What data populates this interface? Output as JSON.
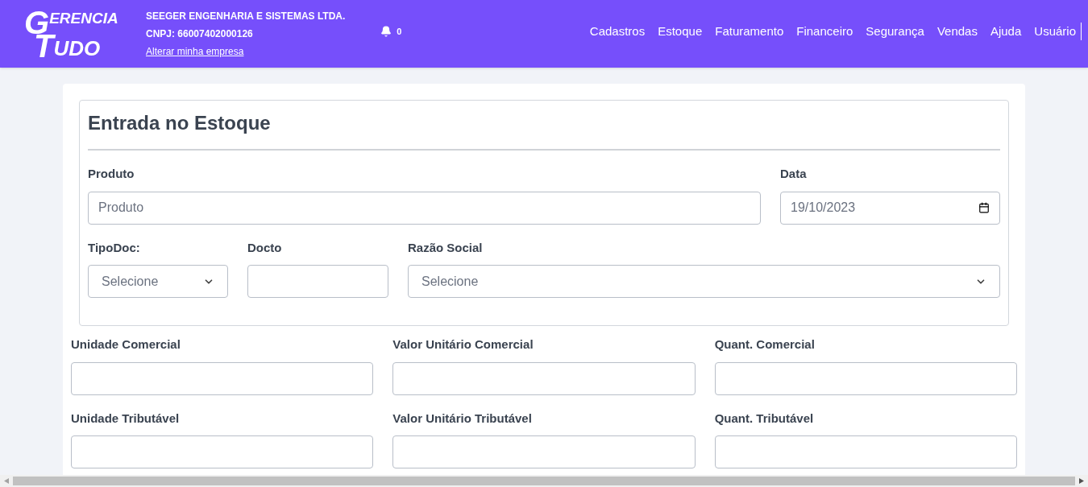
{
  "header": {
    "logo": [
      "G",
      "ERENCIA",
      "T",
      "UDO"
    ],
    "company": "SEEGER ENGENHARIA E SISTEMAS LTDA.",
    "cnpj": "CNPJ: 66007402000126",
    "change_link": "Alterar minha empresa",
    "notifications": "0",
    "nav": [
      "Cadastros",
      "Estoque",
      "Faturamento",
      "Financeiro",
      "Segurança",
      "Vendas",
      "Ajuda",
      "Usuário"
    ]
  },
  "form": {
    "title": "Entrada no Estoque",
    "product": {
      "label": "Produto",
      "placeholder": "Produto"
    },
    "date": {
      "label": "Data",
      "value": "19/10/2023"
    },
    "doc_type": {
      "label": "TipoDoc:",
      "value": "Selecione"
    },
    "doc_number": {
      "label": "Docto"
    },
    "company_name": {
      "label": "Razão Social",
      "value": "Selecione"
    },
    "fields": [
      {
        "label": "Unidade Comercial"
      },
      {
        "label": "Valor Unitário Comercial"
      },
      {
        "label": "Quant. Comercial"
      },
      {
        "label": "Unidade Tributável"
      },
      {
        "label": "Valor Unitário Tributável"
      },
      {
        "label": "Quant. Tributável"
      }
    ]
  }
}
